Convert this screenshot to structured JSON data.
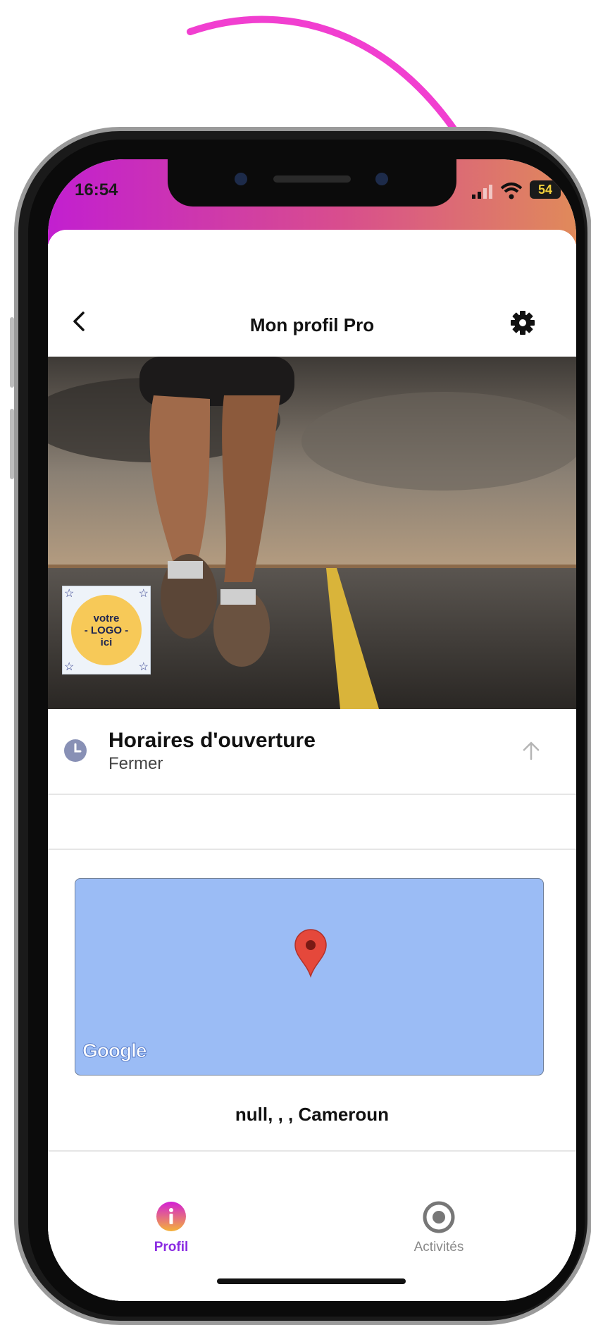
{
  "status_bar": {
    "time": "16:54",
    "battery": "54"
  },
  "header": {
    "title": "Mon profil Pro",
    "back_icon": "chevron-left-icon",
    "settings_icon": "gear-icon"
  },
  "hero": {
    "image": "runner-on-road-photo",
    "logo_lines": [
      "votre",
      "- LOGO -",
      "ici"
    ]
  },
  "opening_hours": {
    "icon": "clock-icon",
    "title": "Horaires d'ouverture",
    "status": "Fermer",
    "collapse_icon": "arrow-up-icon"
  },
  "map": {
    "provider": "Google",
    "marker_icon": "map-pin-icon",
    "address": "null, , , Cameroun"
  },
  "tabs": [
    {
      "label": "Profil",
      "icon": "info-icon",
      "active": true
    },
    {
      "label": "Activités",
      "icon": "target-icon",
      "active": false
    }
  ],
  "colors": {
    "gradient_start": "#c21fd0",
    "gradient_end": "#e08a5a",
    "arrow": "#f13fd0",
    "map_bg": "#9bbcf5",
    "tab_active": "#8a2be2",
    "tab_inactive": "#8a8a8a"
  }
}
